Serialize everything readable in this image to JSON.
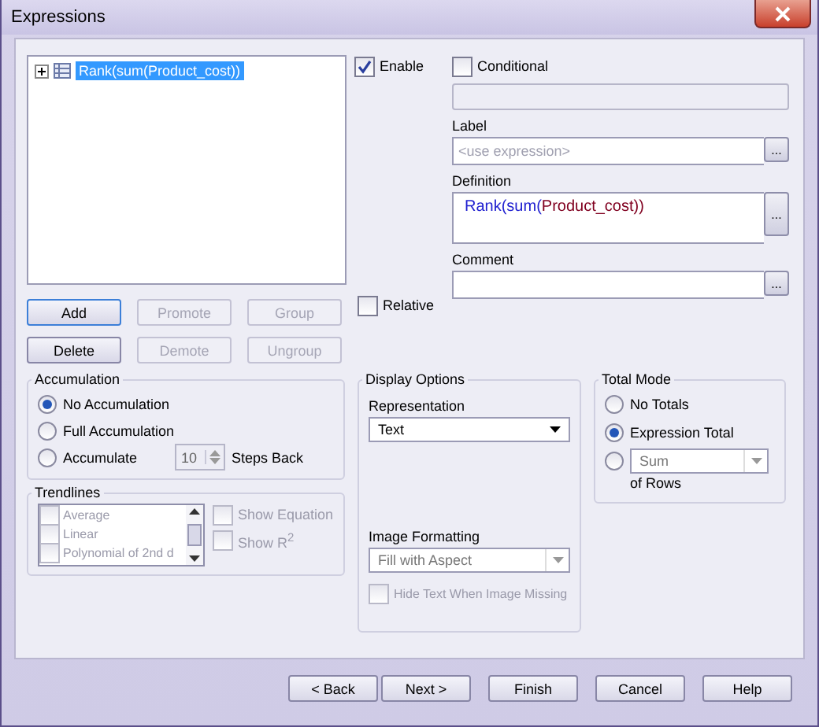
{
  "window": {
    "title": "Expressions"
  },
  "tree": {
    "items": [
      {
        "label": "Rank(sum(Product_cost))",
        "expanded": false,
        "selected": true
      }
    ]
  },
  "expression_buttons": [
    {
      "label": "Add",
      "disabled": false,
      "focused": true
    },
    {
      "label": "Promote",
      "disabled": true,
      "focused": false
    },
    {
      "label": "Group",
      "disabled": true,
      "focused": false
    },
    {
      "label": "Delete",
      "disabled": false,
      "focused": false
    },
    {
      "label": "Demote",
      "disabled": true,
      "focused": false
    },
    {
      "label": "Ungroup",
      "disabled": true,
      "focused": false
    }
  ],
  "enable": {
    "label": "Enable",
    "checked": true
  },
  "conditional": {
    "label": "Conditional",
    "checked": false
  },
  "label_field": {
    "label": "Label",
    "placeholder": "<use expression>",
    "button": "..."
  },
  "definition": {
    "label": "Definition",
    "tokens": [
      {
        "text": "Rank(sum(",
        "kind": "function"
      },
      {
        "text": "Product_cost))",
        "kind": "field"
      }
    ],
    "button": "..."
  },
  "comment": {
    "label": "Comment",
    "button": "..."
  },
  "relative": {
    "label": "Relative",
    "checked": false
  },
  "accumulation": {
    "title": "Accumulation",
    "options": [
      {
        "label": "No Accumulation",
        "selected": true
      },
      {
        "label": "Full Accumulation",
        "selected": false
      },
      {
        "label": "Accumulate",
        "selected": false
      }
    ],
    "steps": "10",
    "steps_label": "Steps Back"
  },
  "trendlines": {
    "title": "Trendlines",
    "items": [
      {
        "label": "Average",
        "checked": false
      },
      {
        "label": "Linear",
        "checked": false
      },
      {
        "label": "Polynomial of 2nd d",
        "checked": false
      }
    ],
    "show_equation": {
      "label": "Show Equation",
      "checked": false,
      "disabled": true
    },
    "show_r2": {
      "label": "Show R$^{2}$",
      "checked": false,
      "disabled": true
    }
  },
  "display_options": {
    "title": "Display Options",
    "representation_label": "Representation",
    "representation": "Text",
    "image_formatting_label": "Image Formatting",
    "image_formatting": "Fill with Aspect",
    "image_formatting_disabled": true,
    "hide_text": {
      "label": "Hide Text When Image Missing",
      "checked": false,
      "disabled": true
    }
  },
  "total_mode": {
    "title": "Total Mode",
    "options": [
      {
        "label": "No Totals",
        "selected": false,
        "kind": "plain"
      },
      {
        "label": "Expression Total",
        "selected": true,
        "kind": "plain"
      },
      {
        "value": "Sum",
        "suffix": "of Rows",
        "selected": false,
        "kind": "function"
      }
    ]
  },
  "footer_buttons": [
    {
      "label": "< Back"
    },
    {
      "label": "Next >"
    },
    {
      "label": "Finish"
    },
    {
      "label": "Cancel"
    },
    {
      "label": "Help"
    }
  ]
}
